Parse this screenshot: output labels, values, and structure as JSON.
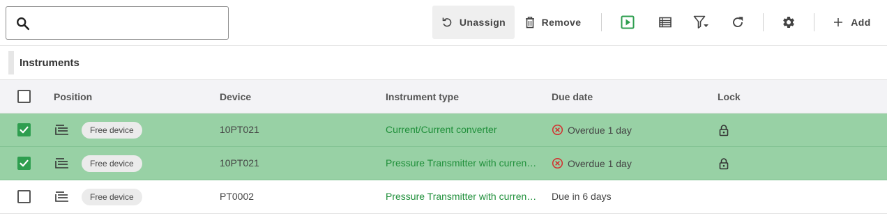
{
  "toolbar": {
    "search_placeholder": "",
    "search_value": "",
    "unassign_label": "Unassign",
    "remove_label": "Remove",
    "add_label": "Add",
    "icons": [
      "search-icon",
      "undo-icon",
      "trash-icon",
      "play-icon",
      "list-view-icon",
      "filter-icon",
      "refresh-icon",
      "gear-icon",
      "plus-icon"
    ]
  },
  "section": {
    "title": "Instruments"
  },
  "table": {
    "columns": {
      "position": "Position",
      "device": "Device",
      "instrument_type": "Instrument type",
      "due_date": "Due date",
      "lock": "Lock"
    },
    "header_checked": false,
    "rows": [
      {
        "checked": true,
        "chip": "Free device",
        "device": "10PT021",
        "instrument_type": "Current/Current converter",
        "due_date": "Overdue 1 day",
        "overdue": true,
        "locked": true
      },
      {
        "checked": true,
        "chip": "Free device",
        "device": "10PT021",
        "instrument_type": "Pressure Transmitter with current output",
        "due_date": "Overdue 1 day",
        "overdue": true,
        "locked": true
      },
      {
        "checked": false,
        "chip": "Free device",
        "device": "PT0002",
        "instrument_type": "Pressure Transmitter with current output",
        "due_date": "Due in 6 days",
        "overdue": false,
        "locked": false
      }
    ]
  },
  "colors": {
    "accent_green": "#2e9e4f",
    "selected_row": "#98d1a5",
    "link_green": "#1f8f3a",
    "overdue_red": "#d32f2f",
    "play_green": "#2e9e4f"
  }
}
